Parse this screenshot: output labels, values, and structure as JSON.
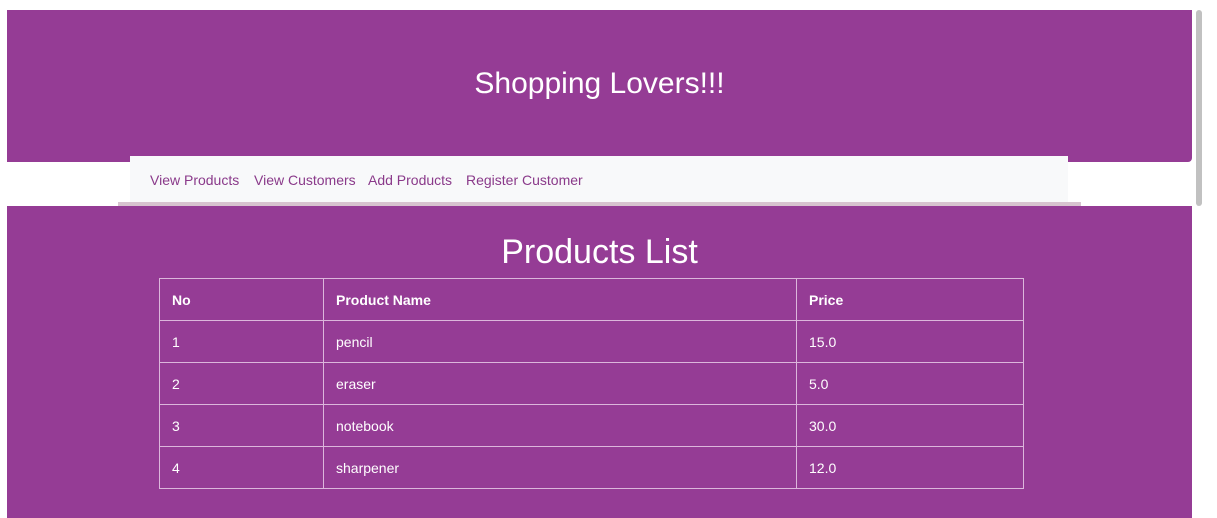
{
  "header": {
    "title": "Shopping Lovers!!!"
  },
  "nav": {
    "items": [
      {
        "label": "View Products"
      },
      {
        "label": "View Customers"
      },
      {
        "label": "Add Products"
      },
      {
        "label": "Register Customer"
      }
    ]
  },
  "main": {
    "heading": "Products List",
    "table": {
      "columns": [
        "No",
        "Product Name",
        "Price"
      ],
      "rows": [
        [
          "1",
          "pencil",
          "15.0"
        ],
        [
          "2",
          "eraser",
          "5.0"
        ],
        [
          "3",
          "notebook",
          "30.0"
        ],
        [
          "4",
          "sharpener",
          "12.0"
        ]
      ]
    }
  },
  "colors": {
    "brand": "#953c95",
    "nav_background": "#f8f9fa",
    "nav_link": "#8a3a8a"
  }
}
